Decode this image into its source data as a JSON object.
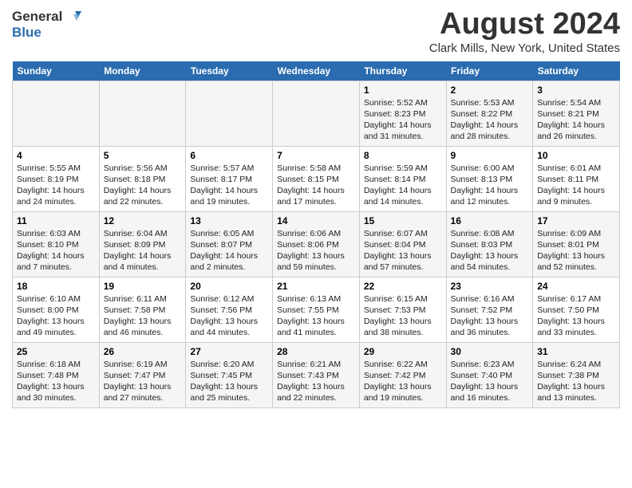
{
  "header": {
    "logo_line1": "General",
    "logo_line2": "Blue",
    "month": "August 2024",
    "location": "Clark Mills, New York, United States"
  },
  "days_of_week": [
    "Sunday",
    "Monday",
    "Tuesday",
    "Wednesday",
    "Thursday",
    "Friday",
    "Saturday"
  ],
  "weeks": [
    [
      {
        "num": "",
        "info": ""
      },
      {
        "num": "",
        "info": ""
      },
      {
        "num": "",
        "info": ""
      },
      {
        "num": "",
        "info": ""
      },
      {
        "num": "1",
        "info": "Sunrise: 5:52 AM\nSunset: 8:23 PM\nDaylight: 14 hours\nand 31 minutes."
      },
      {
        "num": "2",
        "info": "Sunrise: 5:53 AM\nSunset: 8:22 PM\nDaylight: 14 hours\nand 28 minutes."
      },
      {
        "num": "3",
        "info": "Sunrise: 5:54 AM\nSunset: 8:21 PM\nDaylight: 14 hours\nand 26 minutes."
      }
    ],
    [
      {
        "num": "4",
        "info": "Sunrise: 5:55 AM\nSunset: 8:19 PM\nDaylight: 14 hours\nand 24 minutes."
      },
      {
        "num": "5",
        "info": "Sunrise: 5:56 AM\nSunset: 8:18 PM\nDaylight: 14 hours\nand 22 minutes."
      },
      {
        "num": "6",
        "info": "Sunrise: 5:57 AM\nSunset: 8:17 PM\nDaylight: 14 hours\nand 19 minutes."
      },
      {
        "num": "7",
        "info": "Sunrise: 5:58 AM\nSunset: 8:15 PM\nDaylight: 14 hours\nand 17 minutes."
      },
      {
        "num": "8",
        "info": "Sunrise: 5:59 AM\nSunset: 8:14 PM\nDaylight: 14 hours\nand 14 minutes."
      },
      {
        "num": "9",
        "info": "Sunrise: 6:00 AM\nSunset: 8:13 PM\nDaylight: 14 hours\nand 12 minutes."
      },
      {
        "num": "10",
        "info": "Sunrise: 6:01 AM\nSunset: 8:11 PM\nDaylight: 14 hours\nand 9 minutes."
      }
    ],
    [
      {
        "num": "11",
        "info": "Sunrise: 6:03 AM\nSunset: 8:10 PM\nDaylight: 14 hours\nand 7 minutes."
      },
      {
        "num": "12",
        "info": "Sunrise: 6:04 AM\nSunset: 8:09 PM\nDaylight: 14 hours\nand 4 minutes."
      },
      {
        "num": "13",
        "info": "Sunrise: 6:05 AM\nSunset: 8:07 PM\nDaylight: 14 hours\nand 2 minutes."
      },
      {
        "num": "14",
        "info": "Sunrise: 6:06 AM\nSunset: 8:06 PM\nDaylight: 13 hours\nand 59 minutes."
      },
      {
        "num": "15",
        "info": "Sunrise: 6:07 AM\nSunset: 8:04 PM\nDaylight: 13 hours\nand 57 minutes."
      },
      {
        "num": "16",
        "info": "Sunrise: 6:08 AM\nSunset: 8:03 PM\nDaylight: 13 hours\nand 54 minutes."
      },
      {
        "num": "17",
        "info": "Sunrise: 6:09 AM\nSunset: 8:01 PM\nDaylight: 13 hours\nand 52 minutes."
      }
    ],
    [
      {
        "num": "18",
        "info": "Sunrise: 6:10 AM\nSunset: 8:00 PM\nDaylight: 13 hours\nand 49 minutes."
      },
      {
        "num": "19",
        "info": "Sunrise: 6:11 AM\nSunset: 7:58 PM\nDaylight: 13 hours\nand 46 minutes."
      },
      {
        "num": "20",
        "info": "Sunrise: 6:12 AM\nSunset: 7:56 PM\nDaylight: 13 hours\nand 44 minutes."
      },
      {
        "num": "21",
        "info": "Sunrise: 6:13 AM\nSunset: 7:55 PM\nDaylight: 13 hours\nand 41 minutes."
      },
      {
        "num": "22",
        "info": "Sunrise: 6:15 AM\nSunset: 7:53 PM\nDaylight: 13 hours\nand 38 minutes."
      },
      {
        "num": "23",
        "info": "Sunrise: 6:16 AM\nSunset: 7:52 PM\nDaylight: 13 hours\nand 36 minutes."
      },
      {
        "num": "24",
        "info": "Sunrise: 6:17 AM\nSunset: 7:50 PM\nDaylight: 13 hours\nand 33 minutes."
      }
    ],
    [
      {
        "num": "25",
        "info": "Sunrise: 6:18 AM\nSunset: 7:48 PM\nDaylight: 13 hours\nand 30 minutes."
      },
      {
        "num": "26",
        "info": "Sunrise: 6:19 AM\nSunset: 7:47 PM\nDaylight: 13 hours\nand 27 minutes."
      },
      {
        "num": "27",
        "info": "Sunrise: 6:20 AM\nSunset: 7:45 PM\nDaylight: 13 hours\nand 25 minutes."
      },
      {
        "num": "28",
        "info": "Sunrise: 6:21 AM\nSunset: 7:43 PM\nDaylight: 13 hours\nand 22 minutes."
      },
      {
        "num": "29",
        "info": "Sunrise: 6:22 AM\nSunset: 7:42 PM\nDaylight: 13 hours\nand 19 minutes."
      },
      {
        "num": "30",
        "info": "Sunrise: 6:23 AM\nSunset: 7:40 PM\nDaylight: 13 hours\nand 16 minutes."
      },
      {
        "num": "31",
        "info": "Sunrise: 6:24 AM\nSunset: 7:38 PM\nDaylight: 13 hours\nand 13 minutes."
      }
    ]
  ]
}
